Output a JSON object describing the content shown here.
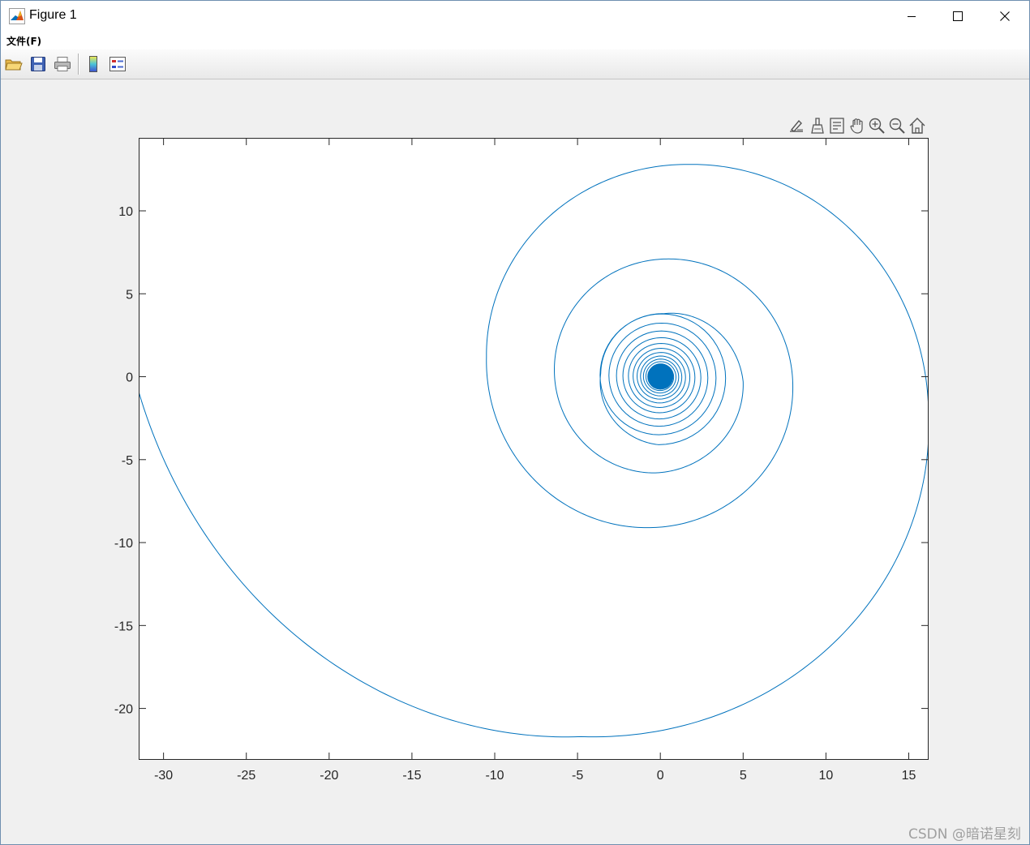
{
  "window": {
    "title": "Figure 1",
    "controls": {
      "minimize": "minimize",
      "maximize": "maximize",
      "close": "close"
    }
  },
  "menubar": {
    "items": [
      {
        "label": "文件(F)"
      }
    ]
  },
  "toolbar": {
    "buttons": [
      {
        "icon": "folder-open-icon"
      },
      {
        "icon": "save-icon"
      },
      {
        "icon": "print-icon"
      },
      {
        "icon": "colorbar-icon"
      },
      {
        "icon": "legend-icon"
      }
    ]
  },
  "axes_toolbar": {
    "icons": [
      "brush-edit-icon",
      "data-brush-icon",
      "data-tips-icon",
      "pan-hand-icon",
      "zoom-in-icon",
      "zoom-out-icon",
      "home-icon"
    ]
  },
  "chart_data": {
    "type": "line",
    "title": "",
    "xlabel": "",
    "ylabel": "",
    "xlim": [
      -31.5,
      16.2
    ],
    "ylim": [
      -23.1,
      14.4
    ],
    "xticks": [
      -30,
      -25,
      -20,
      -15,
      -10,
      -5,
      0,
      5,
      10,
      15
    ],
    "yticks": [
      -20,
      -15,
      -10,
      -5,
      0,
      5,
      10
    ],
    "grid": false,
    "series": [
      {
        "color": "#0072bd",
        "description_points": [
          [
            -31.5,
            -0.9
          ],
          [
            -4.8,
            -21.7
          ],
          [
            16.2,
            -2.5
          ],
          [
            1.7,
            12.8
          ],
          [
            -10.5,
            1.2
          ],
          [
            -0.8,
            -9.1
          ],
          [
            8.0,
            -0.6
          ],
          [
            0.5,
            7.1
          ],
          [
            -6.4,
            0.4
          ],
          [
            -0.3,
            -5.8
          ],
          [
            5.0,
            -0.3
          ],
          [
            0.2,
            3.8
          ],
          [
            -3.6,
            0.2
          ],
          [
            -0.1,
            -4.1
          ],
          [
            0.0,
            0.0
          ]
        ]
      }
    ]
  },
  "watermark": "CSDN @暗诺星刻"
}
